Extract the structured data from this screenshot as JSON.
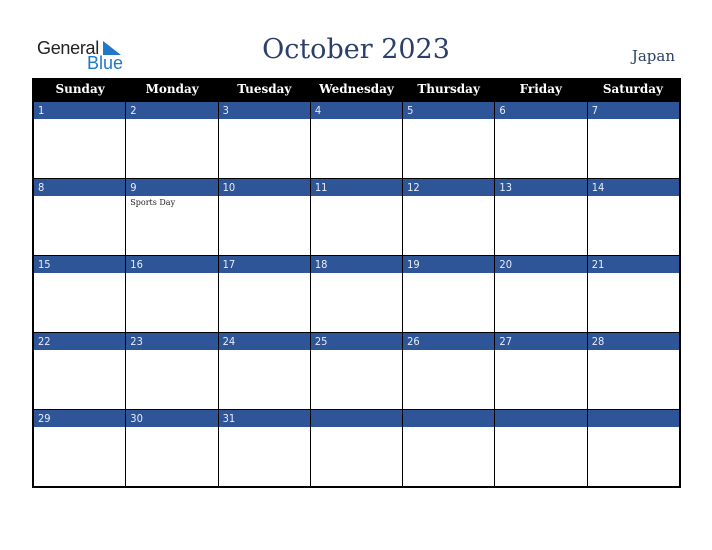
{
  "logo": {
    "line1": "General",
    "line2": "Blue"
  },
  "title": "October 2023",
  "country": "Japan",
  "colors": {
    "band": "#2e5597",
    "header": "#000000",
    "title": "#2b3f6b",
    "logo_blue": "#1f78c8"
  },
  "weekdays": [
    "Sunday",
    "Monday",
    "Tuesday",
    "Wednesday",
    "Thursday",
    "Friday",
    "Saturday"
  ],
  "weeks": [
    [
      {
        "d": "1",
        "e": ""
      },
      {
        "d": "2",
        "e": ""
      },
      {
        "d": "3",
        "e": ""
      },
      {
        "d": "4",
        "e": ""
      },
      {
        "d": "5",
        "e": ""
      },
      {
        "d": "6",
        "e": ""
      },
      {
        "d": "7",
        "e": ""
      }
    ],
    [
      {
        "d": "8",
        "e": ""
      },
      {
        "d": "9",
        "e": "Sports Day"
      },
      {
        "d": "10",
        "e": ""
      },
      {
        "d": "11",
        "e": ""
      },
      {
        "d": "12",
        "e": ""
      },
      {
        "d": "13",
        "e": ""
      },
      {
        "d": "14",
        "e": ""
      }
    ],
    [
      {
        "d": "15",
        "e": ""
      },
      {
        "d": "16",
        "e": ""
      },
      {
        "d": "17",
        "e": ""
      },
      {
        "d": "18",
        "e": ""
      },
      {
        "d": "19",
        "e": ""
      },
      {
        "d": "20",
        "e": ""
      },
      {
        "d": "21",
        "e": ""
      }
    ],
    [
      {
        "d": "22",
        "e": ""
      },
      {
        "d": "23",
        "e": ""
      },
      {
        "d": "24",
        "e": ""
      },
      {
        "d": "25",
        "e": ""
      },
      {
        "d": "26",
        "e": ""
      },
      {
        "d": "27",
        "e": ""
      },
      {
        "d": "28",
        "e": ""
      }
    ],
    [
      {
        "d": "29",
        "e": ""
      },
      {
        "d": "30",
        "e": ""
      },
      {
        "d": "31",
        "e": ""
      },
      {
        "d": "",
        "e": ""
      },
      {
        "d": "",
        "e": ""
      },
      {
        "d": "",
        "e": ""
      },
      {
        "d": "",
        "e": ""
      }
    ]
  ]
}
